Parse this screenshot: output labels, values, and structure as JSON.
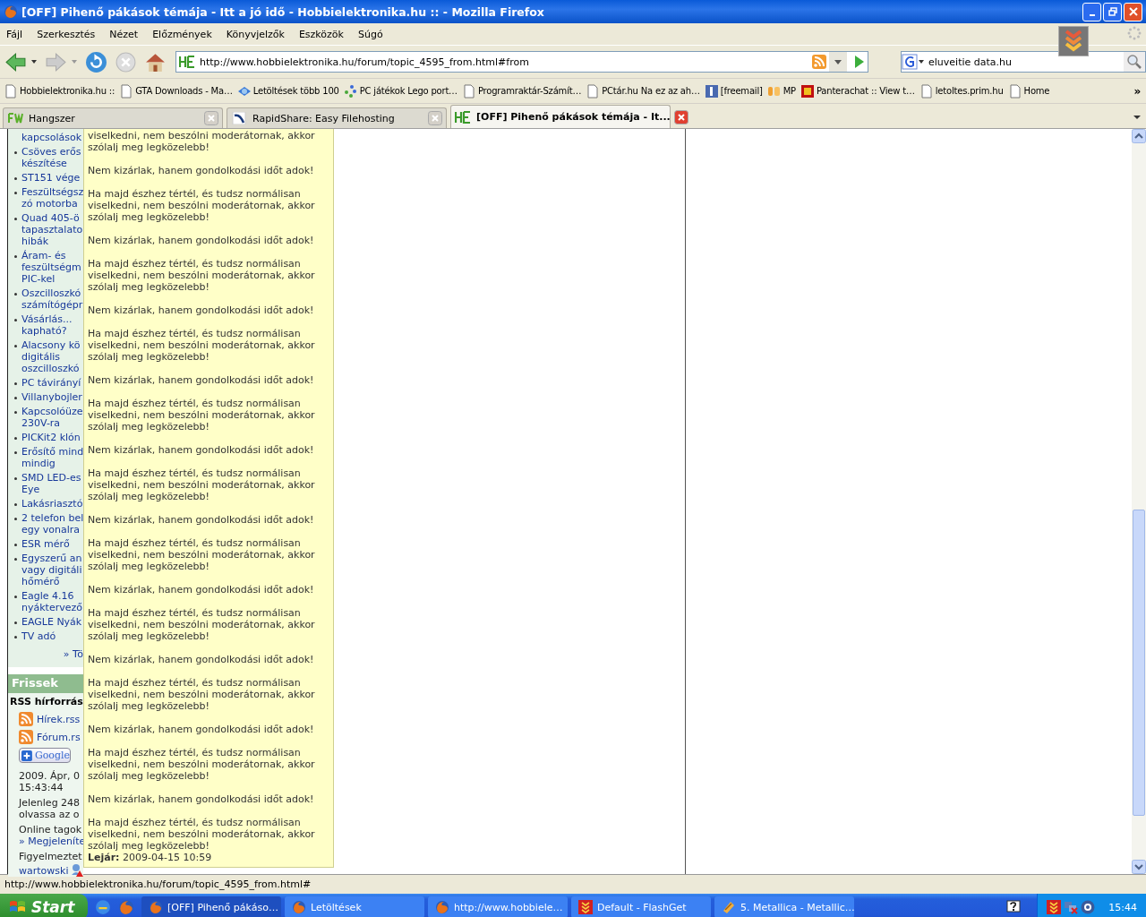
{
  "window": {
    "title": "[OFF] Pihenő pákások témája - Itt a jó idő - Hobbielektronika.hu :: - Mozilla Firefox"
  },
  "menu": [
    "Fájl",
    "Szerkesztés",
    "Nézet",
    "Előzmények",
    "Könyvjelzők",
    "Eszközök",
    "Súgó"
  ],
  "address": {
    "value": "http://www.hobbielektronika.hu/forum/topic_4595_from.html#from"
  },
  "search": {
    "value": "eluveitie data.hu"
  },
  "bookmarks": [
    {
      "label": "Hobbielektronika.hu ::",
      "kind": "page"
    },
    {
      "label": "GTA Downloads - Ma…",
      "kind": "page"
    },
    {
      "label": "Letöltések több 100",
      "kind": "globe"
    },
    {
      "label": "PC játékok Lego port…",
      "kind": "dots"
    },
    {
      "label": "Programraktár-Számít…",
      "kind": "page"
    },
    {
      "label": "PCtár.hu Na ez az ah…",
      "kind": "page"
    },
    {
      "label": "[freemail]",
      "kind": "square"
    },
    {
      "label": "MP",
      "kind": "blog"
    },
    {
      "label": "Panterachat :: View t…",
      "kind": "red"
    },
    {
      "label": "letoltes.prim.hu",
      "kind": "page"
    },
    {
      "label": "Home",
      "kind": "page"
    }
  ],
  "bookmarks_more": "»",
  "tabs": [
    {
      "label": "Hangszer",
      "kind": "fw",
      "selected": false
    },
    {
      "label": "RapidShare: Easy Filehosting",
      "kind": "rs",
      "selected": false
    },
    {
      "label": "[OFF] Pihenő pákások témája - It...",
      "kind": "he",
      "selected": true
    }
  ],
  "sidebar": {
    "top_fragment": "kapcsolások",
    "items": [
      {
        "lines": [
          "Csöves erős",
          "készítése"
        ]
      },
      {
        "lines": [
          "ST151 vége"
        ]
      },
      {
        "lines": [
          "Feszültségsz",
          "zó motorba"
        ]
      },
      {
        "lines": [
          "Quad 405-ö",
          "tapasztalato",
          "hibák"
        ]
      },
      {
        "lines": [
          "Áram- és",
          "feszültségm",
          "PIC-kel"
        ]
      },
      {
        "lines": [
          "Oszcilloszkó",
          "számítógépr"
        ]
      },
      {
        "lines": [
          "Vásárlás...",
          "kapható?"
        ]
      },
      {
        "lines": [
          "Alacsony kö",
          "digitális",
          "oszcilloszkó"
        ]
      },
      {
        "lines": [
          "PC távirányí"
        ]
      },
      {
        "lines": [
          "Villanybojler"
        ]
      },
      {
        "lines": [
          "Kapcsolóüze",
          "230V-ra"
        ]
      },
      {
        "lines": [
          "PICKit2 klón"
        ]
      },
      {
        "lines": [
          "Erősítő mind",
          "mindig"
        ]
      },
      {
        "lines": [
          "SMD LED-es",
          "Eye"
        ]
      },
      {
        "lines": [
          "Lakásriasztó"
        ]
      },
      {
        "lines": [
          "2 telefon bel",
          "egy vonalra"
        ]
      },
      {
        "lines": [
          "ESR mérő"
        ]
      },
      {
        "lines": [
          "Egyszerű an",
          "vagy digitáli",
          "hőmérő"
        ]
      },
      {
        "lines": [
          "Eagle 4.16",
          "nyáktervező"
        ]
      },
      {
        "lines": [
          "EAGLE Nyák"
        ]
      },
      {
        "lines": [
          "TV adó"
        ]
      }
    ],
    "more": "» Tö",
    "section_title": "Frissek",
    "rss_heading": "RSS hírforrás",
    "feeds": [
      "Hírek.rss",
      "Fórum.rs"
    ],
    "google_button": "Google",
    "info": [
      {
        "kind": "text",
        "lines": [
          "2009. Ápr, 0",
          "15:43:44"
        ]
      },
      {
        "kind": "text",
        "lines": [
          "Jelenleg 248",
          "olvassa az o"
        ]
      },
      {
        "kind": "text",
        "lines": [
          "Online tagok"
        ]
      },
      {
        "kind": "link",
        "lines": [
          "» Megjeleníte"
        ]
      },
      {
        "kind": "text",
        "lines": [
          "Figyelmeztet"
        ]
      },
      {
        "kind": "user",
        "lines": [
          "wartowski"
        ]
      }
    ]
  },
  "tooltip": {
    "paragraphs": [
      "viselkedni, nem beszólni moderátornak, akkor szólalj meg legközelebb!",
      "Nem kizárlak, hanem gondolkodási időt adok!",
      "Ha majd észhez tértél, és tudsz normálisan viselkedni, nem beszólni moderátornak, akkor szólalj meg legközelebb!",
      "Nem kizárlak, hanem gondolkodási időt adok!",
      "Ha majd észhez tértél, és tudsz normálisan viselkedni, nem beszólni moderátornak, akkor szólalj meg legközelebb!",
      "Nem kizárlak, hanem gondolkodási időt adok!",
      "Ha majd észhez tértél, és tudsz normálisan viselkedni, nem beszólni moderátornak, akkor szólalj meg legközelebb!",
      "Nem kizárlak, hanem gondolkodási időt adok!",
      "Ha majd észhez tértél, és tudsz normálisan viselkedni, nem beszólni moderátornak, akkor szólalj meg legközelebb!",
      "Nem kizárlak, hanem gondolkodási időt adok!",
      "Ha majd észhez tértél, és tudsz normálisan viselkedni, nem beszólni moderátornak, akkor szólalj meg legközelebb!",
      "Nem kizárlak, hanem gondolkodási időt adok!",
      "Ha majd észhez tértél, és tudsz normálisan viselkedni, nem beszólni moderátornak, akkor szólalj meg legközelebb!",
      "Nem kizárlak, hanem gondolkodási időt adok!",
      "Ha majd észhez tértél, és tudsz normálisan viselkedni, nem beszólni moderátornak, akkor szólalj meg legközelebb!",
      "Nem kizárlak, hanem gondolkodási időt adok!",
      "Ha majd észhez tértél, és tudsz normálisan viselkedni, nem beszólni moderátornak, akkor szólalj meg legközelebb!",
      "Nem kizárlak, hanem gondolkodási időt adok!",
      "Ha majd észhez tértél, és tudsz normálisan viselkedni, nem beszólni moderátornak, akkor szólalj meg legközelebb!",
      "Nem kizárlak, hanem gondolkodási időt adok!",
      "Ha majd észhez tértél, és tudsz normálisan viselkedni, nem beszólni moderátornak, akkor szólalj meg legközelebb!"
    ],
    "expiry_label": "Lejár:",
    "expiry_value": "2009-04-15 10:59"
  },
  "status_bar": "http://www.hobbielektronika.hu/forum/topic_4595_from.html#",
  "taskbar": {
    "start": "Start",
    "tasks": [
      {
        "label": "[OFF] Pihenő pákáso…",
        "kind": "firefox",
        "selected": true
      },
      {
        "label": "Letöltések",
        "kind": "firefox",
        "selected": false
      },
      {
        "label": "http://www.hobbiele…",
        "kind": "firefox",
        "selected": false
      },
      {
        "label": "Default - FlashGet",
        "kind": "flashget",
        "selected": false
      },
      {
        "label": "5. Metallica - Metallic…",
        "kind": "player",
        "selected": false
      }
    ],
    "clock": "15:44"
  }
}
